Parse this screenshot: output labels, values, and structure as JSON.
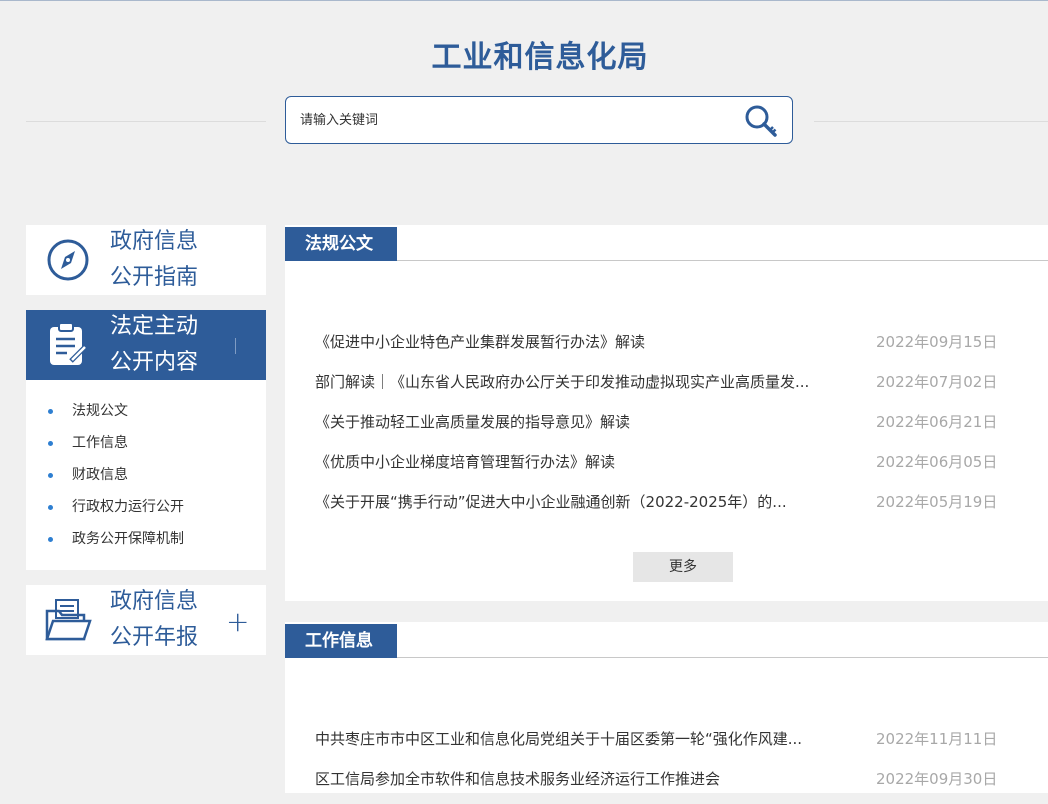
{
  "header": {
    "title": "工业和信息化局",
    "search_placeholder": "请输入关键词",
    "search_icon": "magnifier-key-icon"
  },
  "sidebar": {
    "guide": {
      "line1": "政府信息",
      "line2": "公开指南",
      "icon": "compass-icon"
    },
    "active": {
      "line1": "法定主动",
      "line2": "公开内容",
      "icon": "clipboard-edit-icon"
    },
    "items": [
      {
        "label": "法规公文"
      },
      {
        "label": "工作信息"
      },
      {
        "label": "财政信息"
      },
      {
        "label": "行政权力运行公开"
      },
      {
        "label": "政务公开保障机制"
      }
    ],
    "report": {
      "line1": "政府信息",
      "line2": "公开年报",
      "icon": "folder-docs-icon",
      "expand": "+"
    }
  },
  "sections": [
    {
      "tab": "法规公文",
      "items": [
        {
          "title": "《促进中小企业特色产业集群发展暂行办法》解读",
          "date": "2022年09月15日"
        },
        {
          "title": "部门解读｜《山东省人民政府办公厅关于印发推动虚拟现实产业高质量发...",
          "date": "2022年07月02日"
        },
        {
          "title": "《关于推动轻工业高质量发展的指导意见》解读",
          "date": "2022年06月21日"
        },
        {
          "title": "《优质中小企业梯度培育管理暂行办法》解读",
          "date": "2022年06月05日"
        },
        {
          "title": "《关于开展“携手行动”促进大中小企业融通创新（2022-2025年）的...",
          "date": "2022年05月19日"
        }
      ],
      "more": "更多"
    },
    {
      "tab": "工作信息",
      "items": [
        {
          "title": "中共枣庄市市中区工业和信息化局党组关于十届区委第一轮“强化作风建...",
          "date": "2022年11月11日"
        },
        {
          "title": "区工信局参加全市软件和信息技术服务业经济运行工作推进会",
          "date": "2022年09月30日"
        }
      ]
    }
  ],
  "colors": {
    "primary": "#2e5c99",
    "bullet": "#2e7fd1",
    "date": "#a8a8a8"
  }
}
